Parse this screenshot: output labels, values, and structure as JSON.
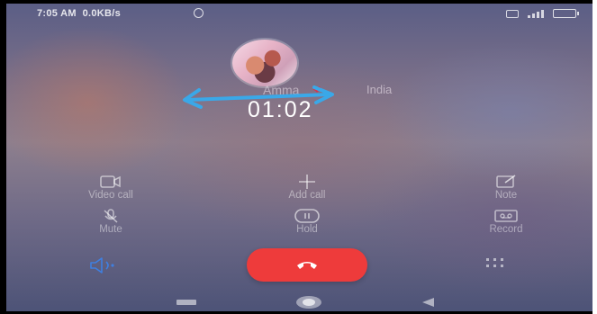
{
  "status_bar": {
    "time": "7:05 AM",
    "speed": "0.0KB/s"
  },
  "caller": {
    "name": "Amma",
    "heart": "❤",
    "location": "India"
  },
  "call_timer": "01:02",
  "actions": {
    "video_call": "Video call",
    "add_call": "Add call",
    "note": "Note",
    "mute": "Mute",
    "hold": "Hold",
    "record": "Record"
  },
  "colors": {
    "end_call": "#ee3b3b",
    "speaker_accent": "#3f7fe0",
    "annotation_arrow": "#3aa8e8"
  },
  "icons": {
    "speaker": "speaker-icon",
    "end_call": "phone-hangup-icon",
    "dialpad": "dialpad-icon"
  }
}
